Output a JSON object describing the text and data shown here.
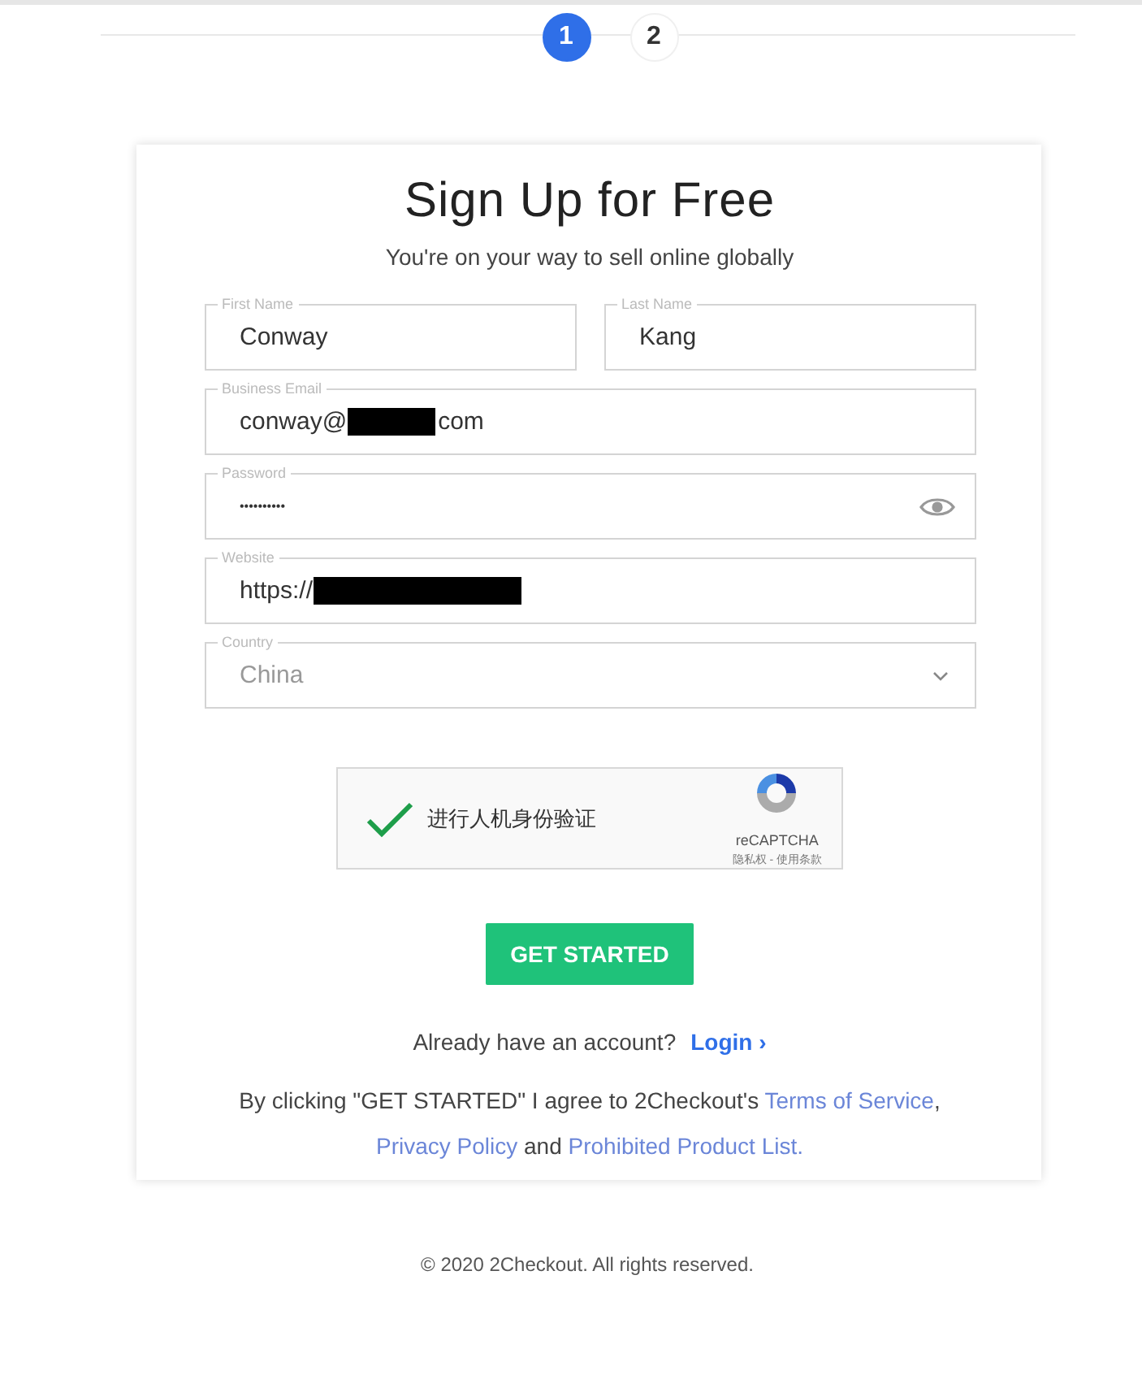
{
  "steps": [
    {
      "label": "1",
      "selected": true
    },
    {
      "label": "2",
      "selected": false
    }
  ],
  "form": {
    "title": "Sign Up for Free",
    "subtitle": "You're on your way to sell online globally",
    "fields": [
      {
        "kind": "text",
        "label": "First Name",
        "value": "Conway",
        "half": true
      },
      {
        "kind": "text",
        "label": "Last Name",
        "value": "Kang",
        "half": true
      },
      {
        "kind": "redacted",
        "label": "Business Email",
        "value": "conway@",
        "value_end": "com"
      },
      {
        "kind": "password",
        "label": "Password",
        "value": "••••••••••"
      },
      {
        "kind": "redacted",
        "label": "Website",
        "value": "https://"
      },
      {
        "kind": "select",
        "label": "Country",
        "value": "China"
      }
    ],
    "captcha": {
      "checked": true,
      "label": "进行人机身份验证",
      "brand": "reCAPTCHA",
      "links": "隐私权 - 使用条款"
    },
    "submit": "GET STARTED",
    "login_prompt": "Already have an account?",
    "login_link": "Login ›",
    "terms": [
      {
        "text": "By clicking \"GET STARTED\" I agree to 2Checkout's ",
        "link": false
      },
      {
        "text": "Terms of Service",
        "link": true
      },
      {
        "text": ", ",
        "link": false
      },
      {
        "text": "Privacy Policy",
        "link": true
      },
      {
        "text": " and ",
        "link": false
      },
      {
        "text": "Prohibited Product List.",
        "link": true
      }
    ]
  },
  "footer": "© 2020 2Checkout. All rights reserved."
}
